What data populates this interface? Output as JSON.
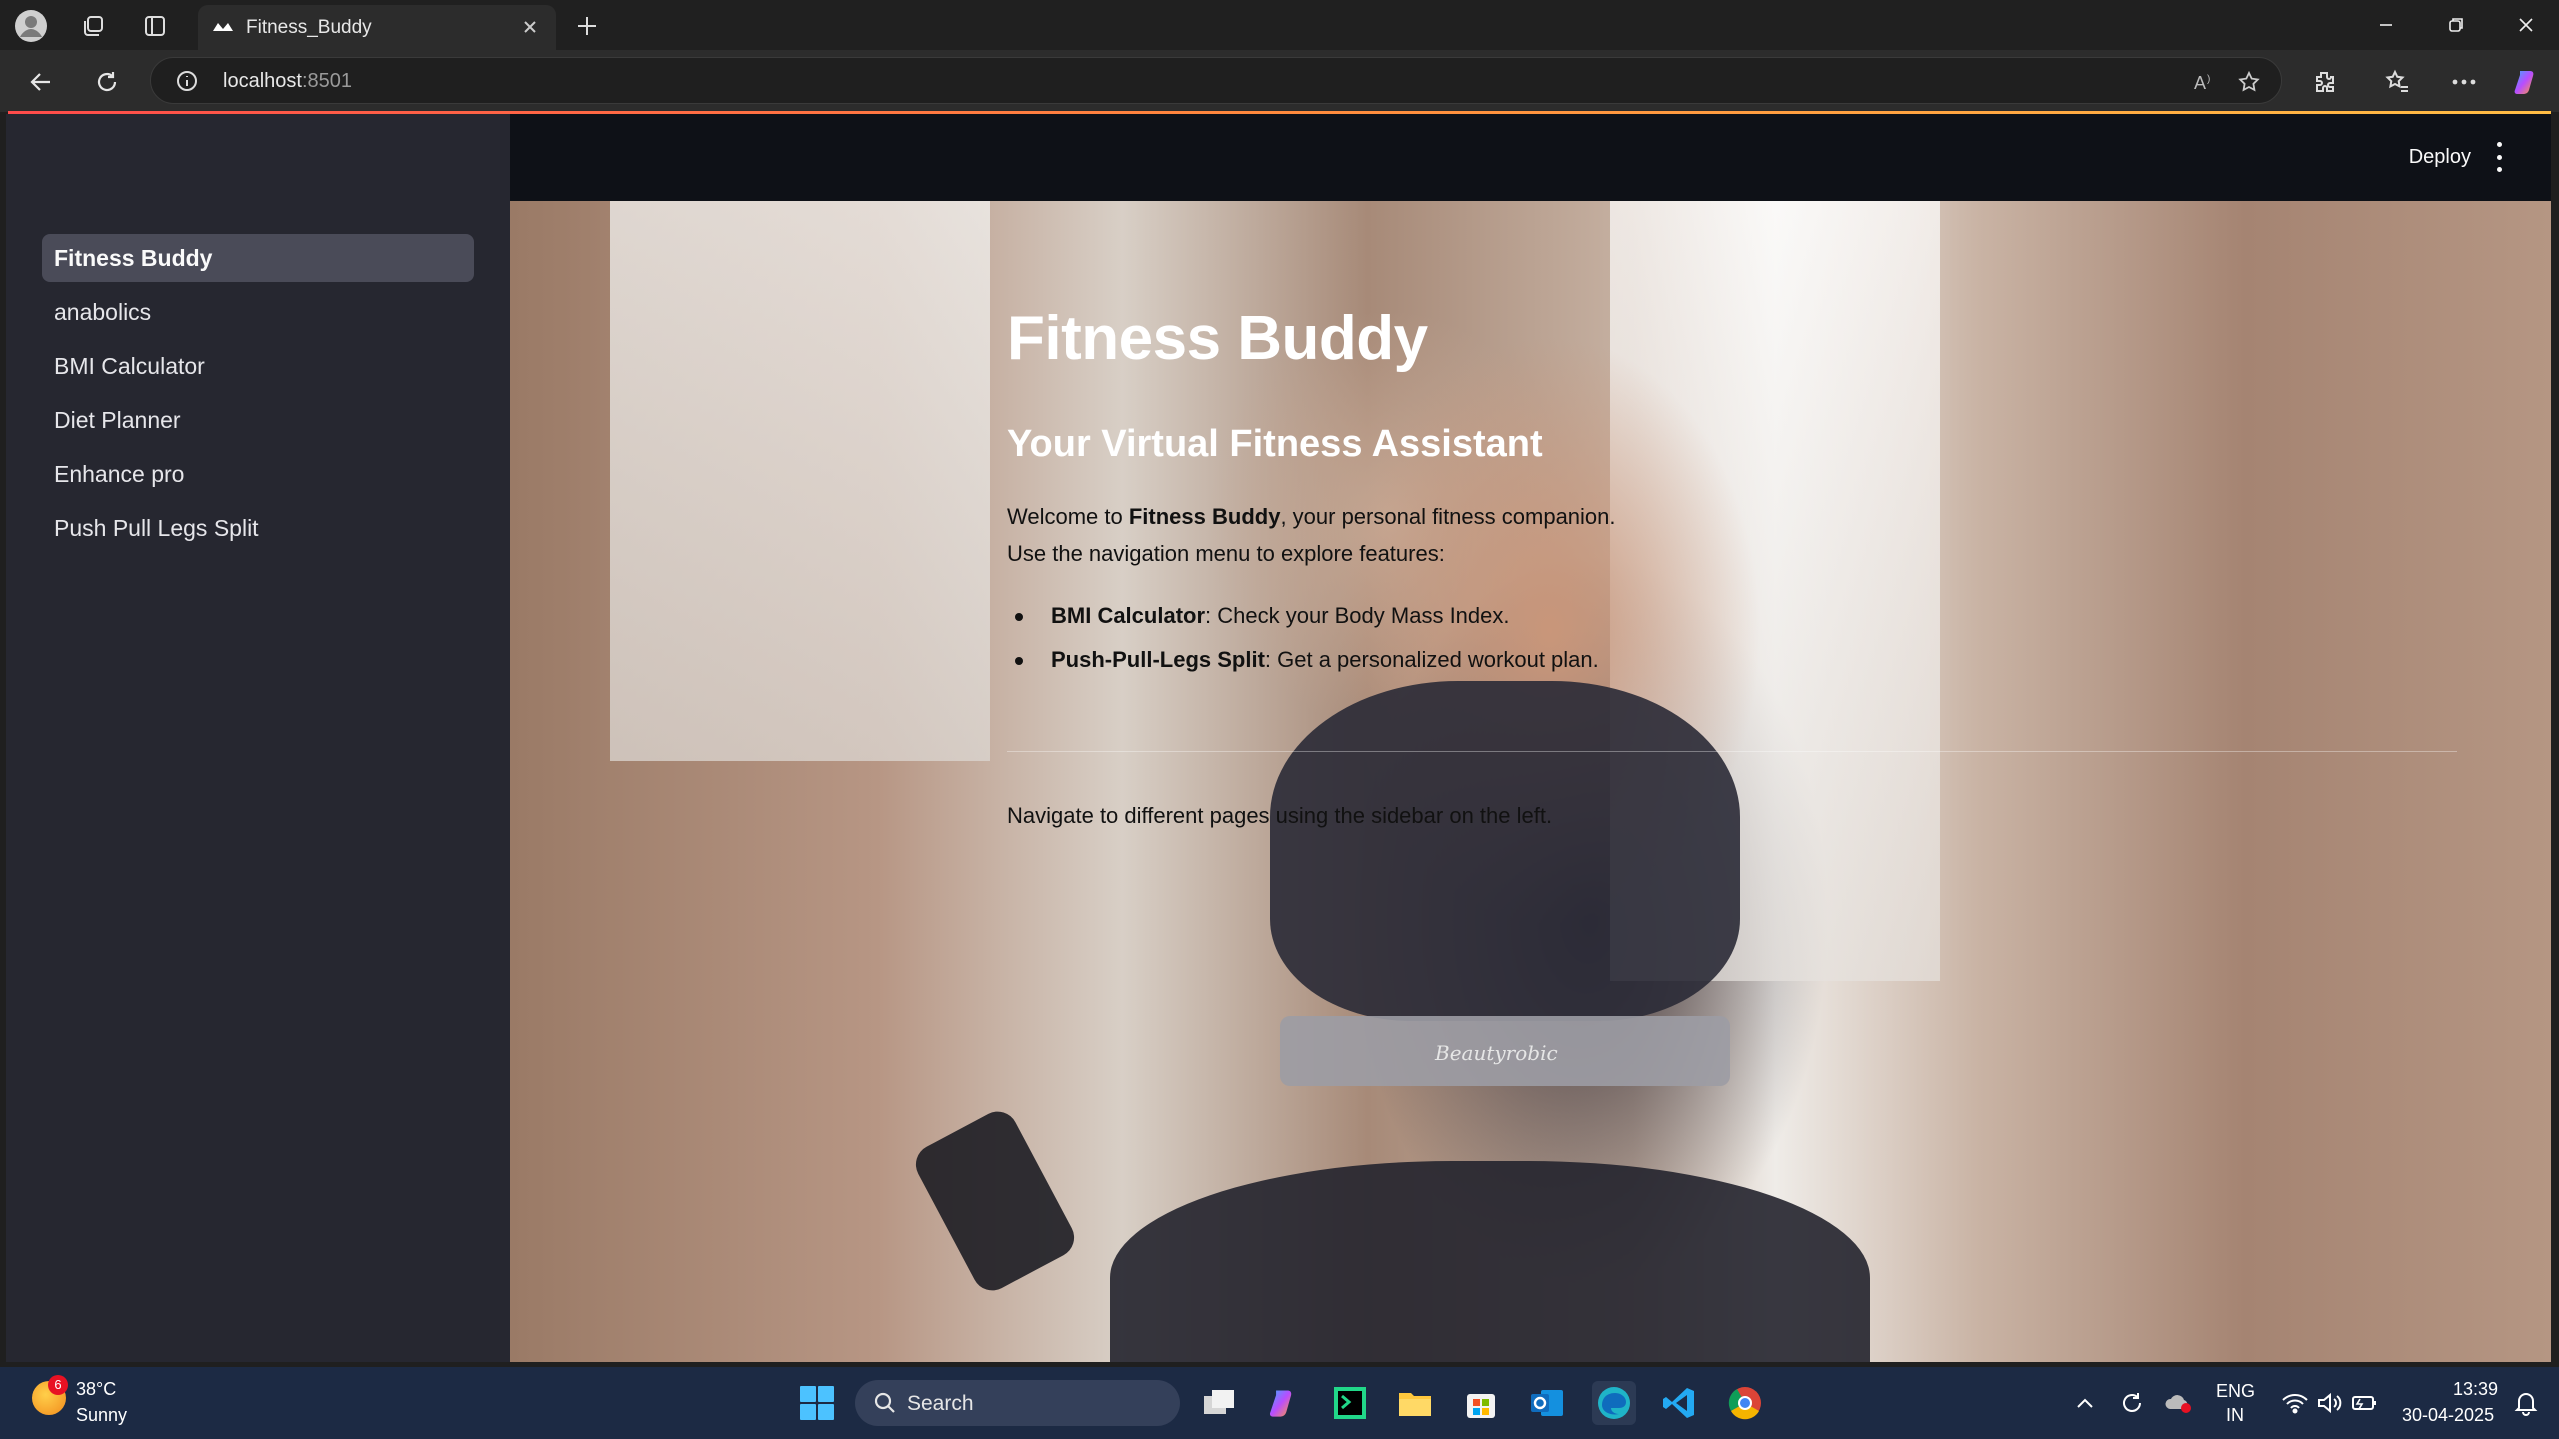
{
  "browser": {
    "tab_title": "Fitness_Buddy",
    "url_host": "localhost",
    "url_port": ":8501"
  },
  "sidebar": {
    "items": [
      {
        "label": "Fitness Buddy",
        "active": true
      },
      {
        "label": "anabolics",
        "active": false
      },
      {
        "label": "BMI Calculator",
        "active": false
      },
      {
        "label": "Diet Planner",
        "active": false
      },
      {
        "label": "Enhance pro",
        "active": false
      },
      {
        "label": "Push Pull Legs Split",
        "active": false
      }
    ]
  },
  "header": {
    "deploy_label": "Deploy"
  },
  "main": {
    "title": "Fitness Buddy",
    "subtitle": "Your Virtual Fitness Assistant",
    "intro_prefix": "Welcome to ",
    "intro_bold": "Fitness Buddy",
    "intro_suffix": ", your personal fitness companion.",
    "intro_line2": "Use the navigation menu to explore features:",
    "features": [
      {
        "name": "BMI Calculator",
        "desc": ": Check your Body Mass Index."
      },
      {
        "name": "Push-Pull-Legs Split",
        "desc": ": Get a personalized workout plan."
      }
    ],
    "footer_text": "Navigate to different pages using the sidebar on the left.",
    "image_logo_text": "Beautyrobic"
  },
  "taskbar": {
    "weather_badge": "6",
    "weather_temp": "38°C",
    "weather_desc": "Sunny",
    "search_label": "Search",
    "lang_top": "ENG",
    "lang_bottom": "IN",
    "time": "13:39",
    "date": "30-04-2025"
  },
  "colors": {
    "sidebar_bg": "#262730",
    "app_bg": "#0e1117",
    "active_item_bg": "#4a4b58",
    "taskbar_bg": "#1c2a44"
  }
}
